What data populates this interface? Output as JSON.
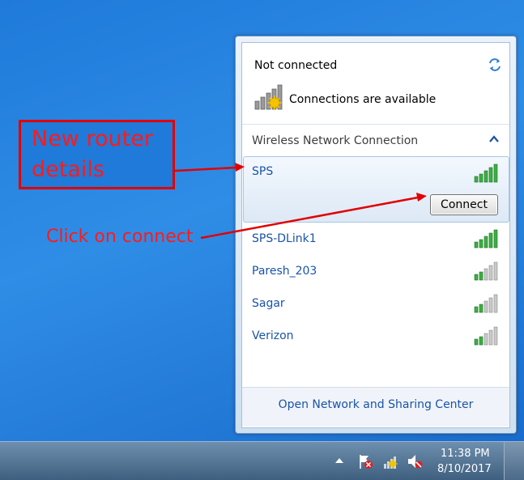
{
  "flyout": {
    "status_title": "Not connected",
    "connections_available": "Connections are available",
    "section_title": "Wireless Network Connection",
    "networks": [
      {
        "name": "SPS",
        "selected": true,
        "signal_bars": 5
      },
      {
        "name": "SPS-DLink1",
        "selected": false,
        "signal_bars": 5
      },
      {
        "name": "Paresh_203",
        "selected": false,
        "signal_bars": 2
      },
      {
        "name": "Sagar",
        "selected": false,
        "signal_bars": 2
      },
      {
        "name": "Verizon",
        "selected": false,
        "signal_bars": 2
      }
    ],
    "connect_label": "Connect",
    "footer_link": "Open Network and Sharing Center"
  },
  "annotations": {
    "router_note_line1": "New router",
    "router_note_line2": "details",
    "connect_note": "Click on connect",
    "color": "#ff1a1a"
  },
  "taskbar": {
    "time": "11:38 PM",
    "date": "8/10/2017",
    "tray_icons": [
      "show-hidden-icons-arrow",
      "action-center-flag-icon",
      "network-warning-icon",
      "volume-muted-icon"
    ]
  },
  "colors": {
    "link": "#1a53a8",
    "desktop": "#1f7ad9",
    "annotation": "#e20000"
  }
}
